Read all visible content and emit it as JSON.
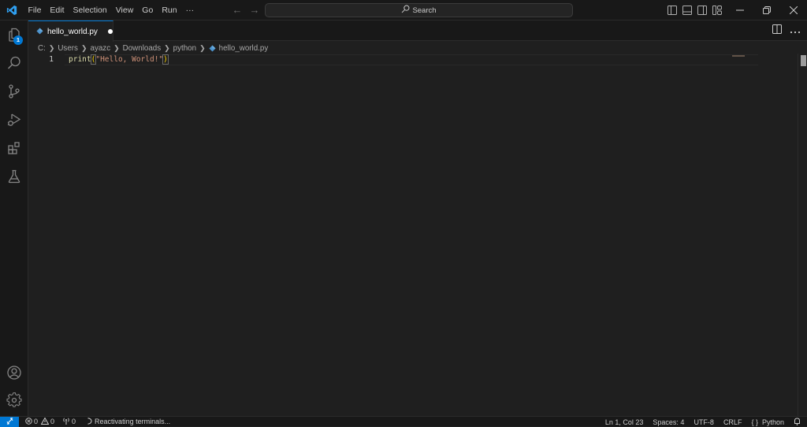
{
  "titlebar": {
    "menu": [
      "File",
      "Edit",
      "Selection",
      "View",
      "Go",
      "Run",
      "···"
    ],
    "search_label": "Search",
    "nav_back": "←",
    "nav_forward": "→"
  },
  "activitybar": {
    "explorer_badge": "1",
    "items": [
      "explorer",
      "search",
      "source-control",
      "run-and-debug",
      "extensions",
      "testing"
    ],
    "bottom_items": [
      "accounts",
      "manage"
    ]
  },
  "tabs": [
    {
      "label": "hello_world.py",
      "modified": true,
      "active": true
    }
  ],
  "breadcrumb": [
    "C:",
    "Users",
    "ayazc",
    "Downloads",
    "python",
    "hello_world.py"
  ],
  "editor": {
    "lines": [
      {
        "number": "1",
        "tokens": {
          "fn": "print",
          "open": "(",
          "str": "\"Hello, World!\"",
          "close": ")"
        }
      }
    ]
  },
  "statusbar": {
    "errors": "0",
    "warnings": "0",
    "ports": "0",
    "activity": "Reactivating terminals...",
    "cursor": "Ln 1, Col 23",
    "indent": "Spaces: 4",
    "encoding": "UTF-8",
    "eol": "CRLF",
    "language_icon": "{ }",
    "language": "Python"
  },
  "colors": {
    "accent": "#0078d4",
    "background": "#1f1f1f",
    "chrome": "#181818"
  }
}
